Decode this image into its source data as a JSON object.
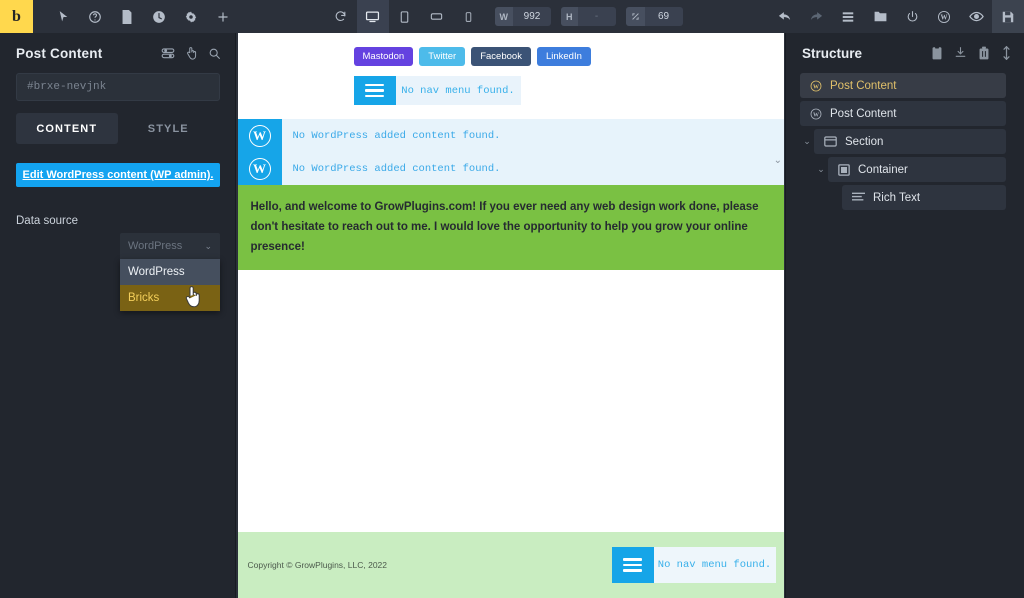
{
  "toolbar": {
    "logo": "b",
    "left_icons": [
      {
        "name": "cursor-icon",
        "label": "Select"
      },
      {
        "name": "help-icon",
        "label": "Help"
      },
      {
        "name": "page-icon",
        "label": "Page"
      },
      {
        "name": "history-icon",
        "label": "Revisions"
      },
      {
        "name": "settings-icon",
        "label": "Settings"
      },
      {
        "name": "plus-icon",
        "label": "Add element"
      }
    ],
    "center_icons": [
      {
        "name": "refresh-icon",
        "label": "Reload"
      },
      {
        "name": "desktop-icon",
        "label": "Desktop",
        "active": true
      },
      {
        "name": "tablet-portrait-icon",
        "label": "Tablet portrait"
      },
      {
        "name": "tablet-landscape-icon",
        "label": "Tablet landscape"
      },
      {
        "name": "mobile-icon",
        "label": "Mobile"
      }
    ],
    "width_label": "W",
    "width_value": "992",
    "height_label": "H",
    "height_value": "-",
    "zoom_value": "69",
    "right_icons": [
      {
        "name": "undo-icon",
        "label": "Undo"
      },
      {
        "name": "redo-icon",
        "label": "Redo",
        "dim": true
      },
      {
        "name": "structure-panel-icon",
        "label": "Structure"
      },
      {
        "name": "templates-icon",
        "label": "Templates"
      },
      {
        "name": "power-icon",
        "label": "Exit"
      },
      {
        "name": "wordpress-icon",
        "label": "WordPress"
      },
      {
        "name": "preview-eye-icon",
        "label": "Preview"
      },
      {
        "name": "save-icon",
        "label": "Save"
      }
    ]
  },
  "left_panel": {
    "title": "Post Content",
    "head_icons": [
      {
        "name": "element-settings-icon"
      },
      {
        "name": "interactions-icon"
      },
      {
        "name": "search-icon"
      }
    ],
    "id_placeholder": "#brxe-nevjnk",
    "id_value": "",
    "tabs": [
      {
        "label": "CONTENT",
        "active": true
      },
      {
        "label": "STYLE",
        "active": false
      }
    ],
    "edit_button": "Edit WordPress content (WP admin).",
    "data_source_label": "Data source",
    "data_source_value": "WordPress",
    "data_source_options": [
      {
        "label": "WordPress",
        "selected": false
      },
      {
        "label": "Bricks",
        "selected": true
      }
    ]
  },
  "canvas": {
    "social_buttons": [
      {
        "label": "Mastodon",
        "color": "#6442e0"
      },
      {
        "label": "Twitter",
        "color": "#4dbbea"
      },
      {
        "label": "Facebook",
        "color": "#3b5376"
      },
      {
        "label": "LinkedIn",
        "color": "#3d7ddd"
      }
    ],
    "header_nav_message": "No nav menu found.",
    "wp_placeholders": [
      "No WordPress added content found.",
      "No WordPress added content found."
    ],
    "welcome_text": "Hello, and welcome to GrowPlugins.com! If you ever need any web design work done, please don't hesitate to reach out to me. I would love the opportunity to help you grow your online presence!",
    "footer_copyright": "Copyright © GrowPlugins, LLC, 2022",
    "footer_nav_message": "No nav menu found.",
    "accent_blue": "#16a5e8",
    "green_section": "#7ac143",
    "footer_green": "#c9edc1"
  },
  "right_panel": {
    "title": "Structure",
    "head_icons": [
      {
        "name": "paste-icon"
      },
      {
        "name": "import-icon"
      },
      {
        "name": "delete-icon"
      },
      {
        "name": "expand-collapse-icon"
      }
    ],
    "tree": [
      {
        "label": "Post Content",
        "icon": "wordpress-icon",
        "indent": 0,
        "chevron": "",
        "selected": true
      },
      {
        "label": "Post Content",
        "icon": "wordpress-icon",
        "indent": 0,
        "chevron": "",
        "selected": false
      },
      {
        "label": "Section",
        "icon": "section-icon",
        "indent": 1,
        "chevron": "⌄",
        "selected": false
      },
      {
        "label": "Container",
        "icon": "container-icon",
        "indent": 2,
        "chevron": "⌄",
        "selected": false
      },
      {
        "label": "Rich Text",
        "icon": "rich-text-icon",
        "indent": 3,
        "chevron": "",
        "selected": false
      }
    ]
  }
}
